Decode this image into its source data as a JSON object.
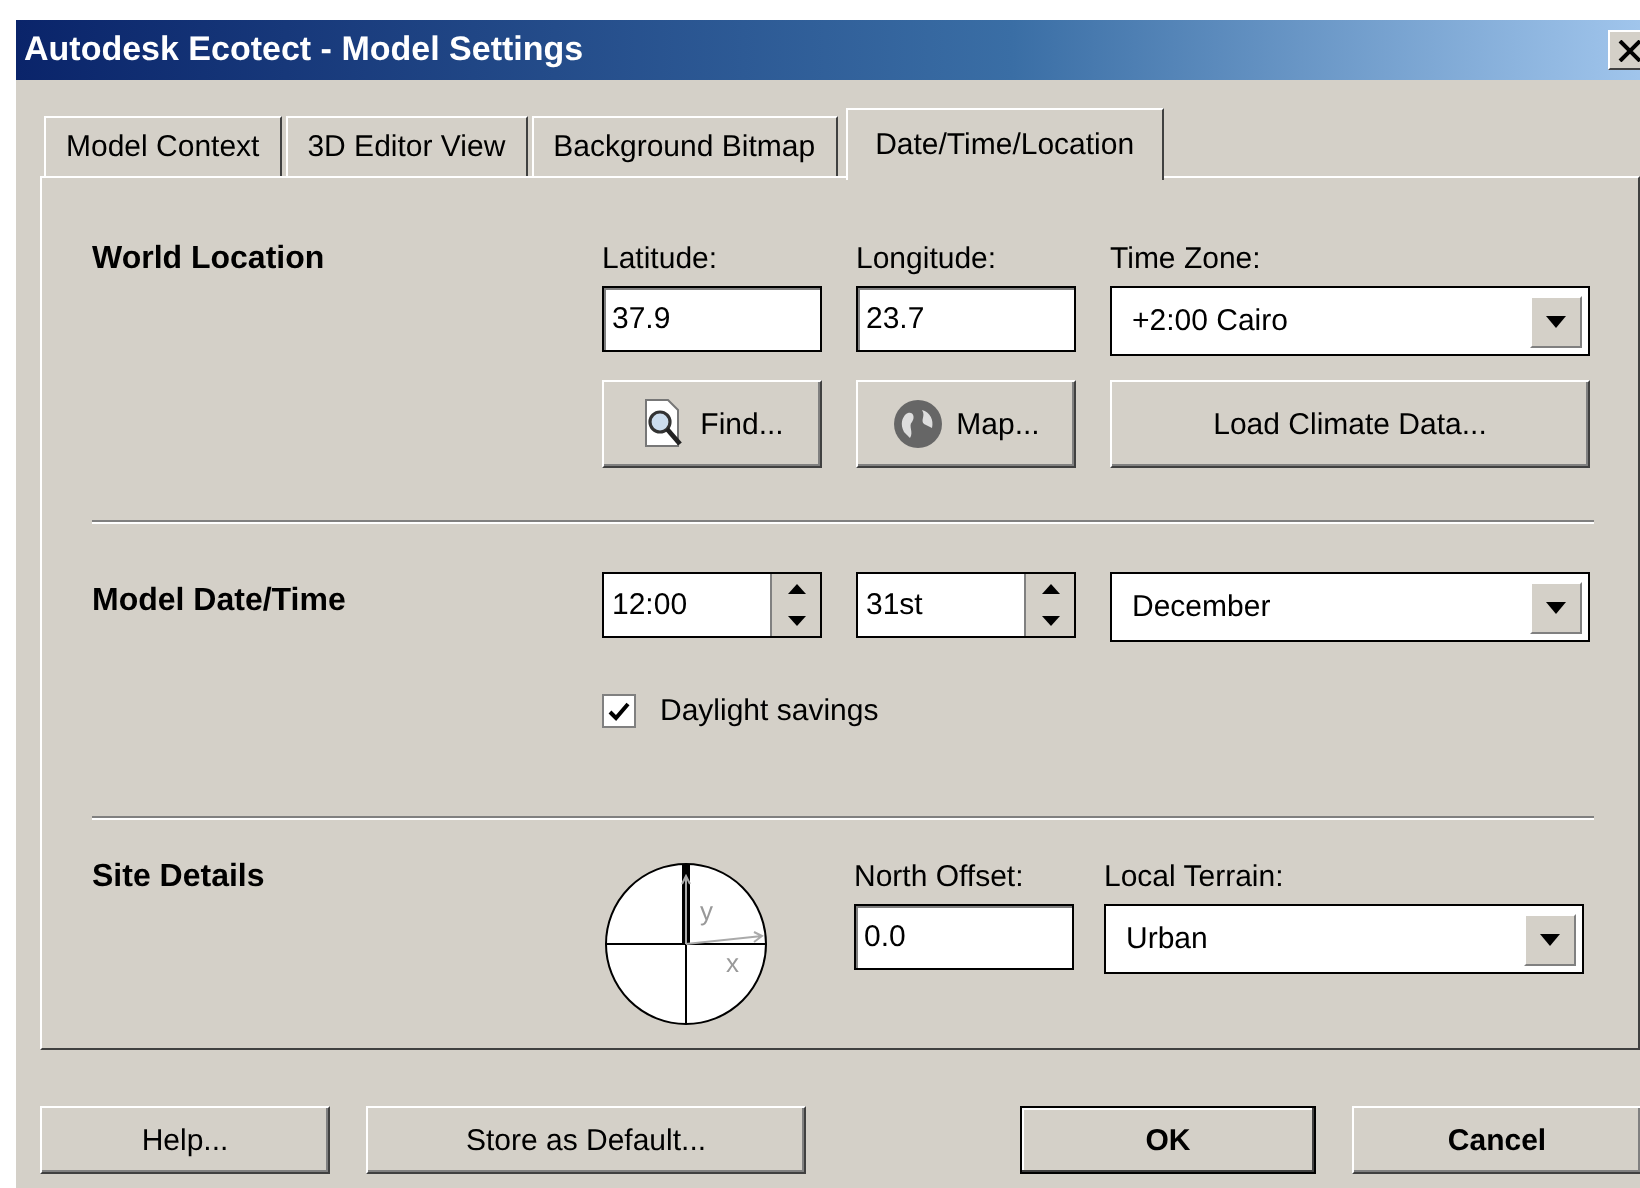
{
  "window": {
    "title": "Autodesk Ecotect - Model Settings"
  },
  "tabs": [
    {
      "label": "Model Context",
      "selected": false
    },
    {
      "label": "3D Editor View",
      "selected": false
    },
    {
      "label": "Background Bitmap",
      "selected": false
    },
    {
      "label": "Date/Time/Location",
      "selected": true
    }
  ],
  "world_location": {
    "heading": "World Location",
    "latitude": {
      "label": "Latitude:",
      "value": "37.9"
    },
    "longitude": {
      "label": "Longitude:",
      "value": "23.7"
    },
    "time_zone": {
      "label": "Time Zone:",
      "value": "+2:00 Cairo"
    },
    "buttons": [
      {
        "label": "Find...",
        "kind": "find"
      },
      {
        "label": "Map...",
        "kind": "map"
      },
      {
        "label": "Load Climate Data...",
        "kind": "plain"
      }
    ]
  },
  "model_date_time": {
    "heading": "Model Date/Time",
    "time": "12:00",
    "day": "31st",
    "month": "December",
    "daylight_savings": {
      "label": "Daylight savings",
      "checked": true
    }
  },
  "site_details": {
    "heading": "Site Details",
    "compass": {
      "y_label": "y",
      "x_label": "x"
    },
    "north_offset": {
      "label": "North Offset:",
      "value": "0.0"
    },
    "local_terrain": {
      "label": "Local Terrain:",
      "value": "Urban"
    }
  },
  "buttons": [
    {
      "label": "Help...",
      "default": false
    },
    {
      "label": "Store as Default...",
      "default": false
    },
    {
      "label": "OK",
      "default": true
    },
    {
      "label": "Cancel",
      "default": false
    }
  ]
}
